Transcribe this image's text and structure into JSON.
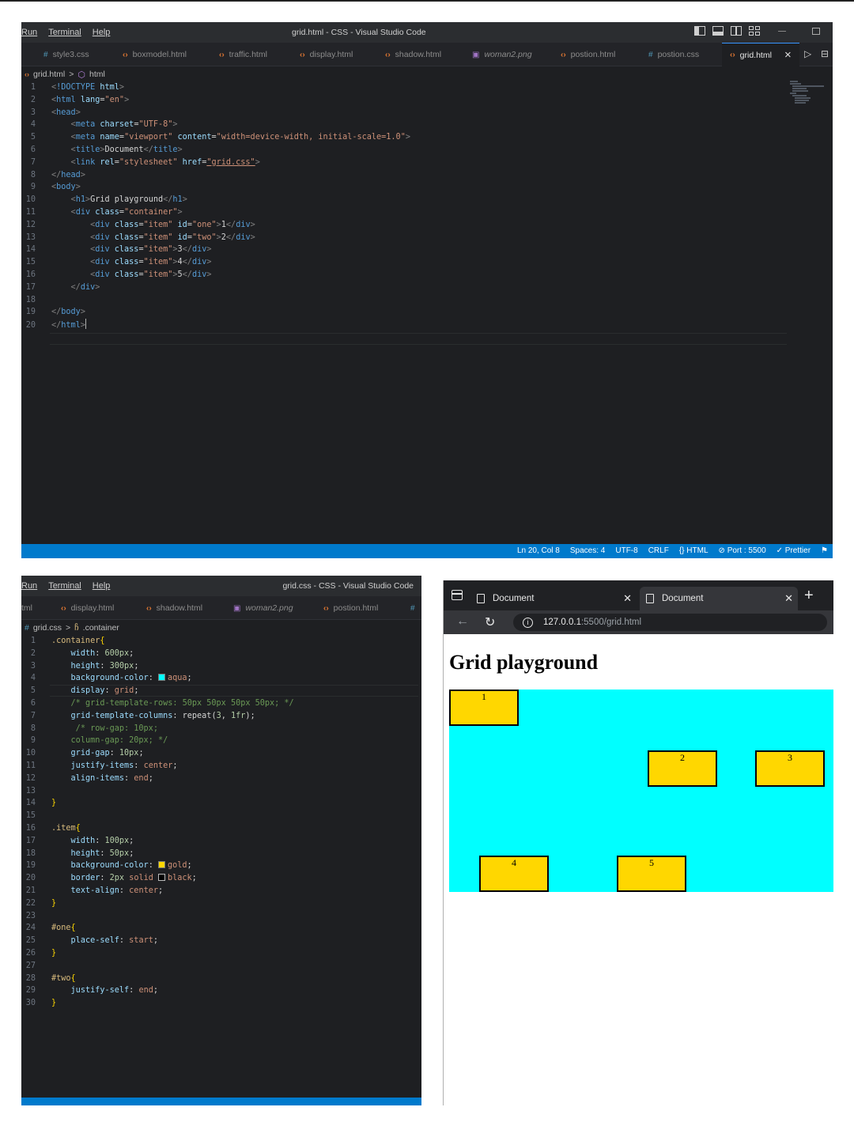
{
  "vscode_html": {
    "menu": [
      "Run",
      "Terminal",
      "Help"
    ],
    "window_title": "grid.html - CSS - Visual Studio Code",
    "tabs": [
      {
        "label": "style3.css",
        "icon": "css-hash-icon"
      },
      {
        "label": "boxmodel.html",
        "icon": "html-icon"
      },
      {
        "label": "traffic.html",
        "icon": "html-icon"
      },
      {
        "label": "display.html",
        "icon": "html-icon"
      },
      {
        "label": "shadow.html",
        "icon": "html-icon"
      },
      {
        "label": "woman2.png",
        "icon": "image-icon"
      },
      {
        "label": "postion.html",
        "icon": "html-icon"
      },
      {
        "label": "postion.css",
        "icon": "css-hash-icon"
      }
    ],
    "active_tab": {
      "label": "grid.html",
      "icon": "html-icon"
    },
    "breadcrumb": {
      "file": "grid.html",
      "separator": ">",
      "symbol": "html"
    },
    "line_numbers": [
      "1",
      "2",
      "3",
      "4",
      "5",
      "6",
      "7",
      "8",
      "9",
      "10",
      "11",
      "12",
      "13",
      "14",
      "15",
      "16",
      "17",
      "18",
      "19",
      "20"
    ],
    "code_text": [
      "<!DOCTYPE html>",
      "<html lang=\"en\">",
      "<head>",
      "<meta charset=\"UTF-8\">",
      "<meta name=\"viewport\" content=\"width=device-width, initial-scale=1.0\">",
      "<title>Document</title>",
      "<link rel=\"stylesheet\" href=\"grid.css\">",
      "</head>",
      "<body>",
      "<h1>Grid playground</h1>",
      "<div class=\"container\">",
      "<div class=\"item\" id=\"one\">1</div>",
      "<div class=\"item\" id=\"two\">2</div>",
      "<div class=\"item\">3</div>",
      "<div class=\"item\">4</div>",
      "<div class=\"item\">5</div>",
      "</div>",
      "",
      "</body>",
      "</html>"
    ],
    "status": {
      "position": "Ln 20, Col 8",
      "spaces": "Spaces: 4",
      "encoding": "UTF-8",
      "eol": "CRLF",
      "language": "HTML",
      "port": "Port : 5500",
      "formatter": "Prettier"
    }
  },
  "vscode_css": {
    "menu": [
      "Run",
      "Terminal",
      "Help"
    ],
    "window_title": "grid.css - CSS - Visual Studio Code",
    "tabs": [
      {
        "label": "tml",
        "icon": "none"
      },
      {
        "label": "display.html",
        "icon": "html-icon"
      },
      {
        "label": "shadow.html",
        "icon": "html-icon"
      },
      {
        "label": "woman2.png",
        "icon": "image-icon"
      },
      {
        "label": "postion.html",
        "icon": "html-icon"
      },
      {
        "label": "",
        "icon": "css-hash-icon"
      }
    ],
    "breadcrumb": {
      "file": "grid.css",
      "separator": ">",
      "symbol": ".container"
    },
    "line_numbers": [
      "1",
      "2",
      "3",
      "4",
      "5",
      "6",
      "7",
      "8",
      "9",
      "10",
      "11",
      "12",
      "13",
      "14",
      "15",
      "16",
      "17",
      "18",
      "19",
      "20",
      "21",
      "22",
      "23",
      "24",
      "25",
      "26",
      "27",
      "28",
      "29",
      "30"
    ],
    "code_text": [
      ".container{",
      "width: 600px;",
      "height: 300px;",
      "background-color: aqua;",
      "display: grid;",
      "/* grid-template-rows: 50px 50px 50px 50px; */",
      "grid-template-columns: repeat(3, 1fr);",
      "/* row-gap: 10px;",
      "column-gap: 20px; */",
      "grid-gap: 10px;",
      "justify-items: center;",
      "align-items: end;",
      "",
      "}",
      "",
      ".item{",
      "width: 100px;",
      "height: 50px;",
      "background-color: gold;",
      "border: 2px solid black;",
      "text-align: center;",
      "}",
      "",
      "#one{",
      "place-self: start;",
      "}",
      "",
      "#two{",
      "justify-self: end;",
      "}"
    ]
  },
  "browser": {
    "tabs": [
      "Document",
      "Document"
    ],
    "url_host": "127.0.0.1",
    "url_path": ":5500/grid.html",
    "page_heading": "Grid playground",
    "grid_items": [
      "1",
      "2",
      "3",
      "4",
      "5"
    ],
    "container_color": "#00ffff",
    "item_color": "#ffd700"
  },
  "colors": {
    "editor_bg": "#1e1f22",
    "status_bar": "#007acc",
    "aqua": "#00ffff",
    "gold": "#ffd700"
  }
}
